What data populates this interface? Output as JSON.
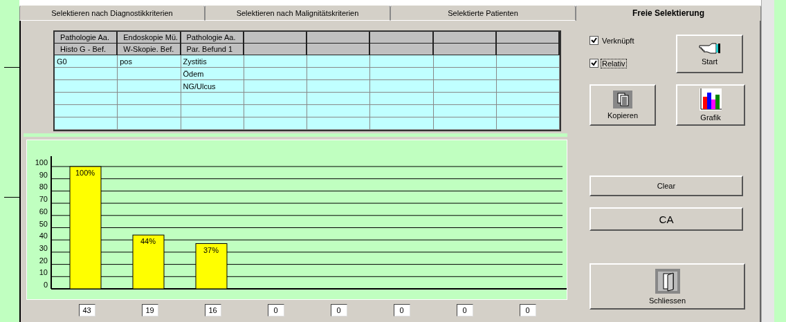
{
  "tabs": [
    {
      "label": "Selektieren nach Diagnostikkriterien",
      "selected": false
    },
    {
      "label": "Selektieren nach Malignitätskriterien",
      "selected": false
    },
    {
      "label": "Selektierte Patienten",
      "selected": false
    },
    {
      "label": "Freie Selektierung",
      "selected": true
    }
  ],
  "table": {
    "columns": [
      {
        "source": "Pathologie Aa.",
        "name": "Histo G - Bef."
      },
      {
        "source": "Endoskopie Mü.",
        "name": "W-Skopie. Bef."
      },
      {
        "source": "Pathologie Aa.",
        "name": "Par. Befund 1"
      }
    ],
    "rows": [
      {
        "cells": [
          "G0",
          "pos",
          "Zystitis"
        ]
      },
      {
        "cells": [
          null,
          null,
          "Ödem"
        ]
      },
      {
        "cells": [
          null,
          null,
          "NG/Ulcus"
        ]
      }
    ]
  },
  "chart_data": {
    "type": "bar",
    "grid": true,
    "ylim": [
      0,
      100
    ],
    "yticks": [
      0,
      10,
      20,
      30,
      40,
      50,
      60,
      70,
      80,
      90,
      100
    ],
    "values": [
      100,
      44,
      37,
      0,
      0,
      0,
      0,
      0
    ],
    "value_labels": [
      "100%",
      "44%",
      "37%",
      null,
      null,
      null,
      null,
      null
    ]
  },
  "counts": [
    "43",
    "19",
    "16",
    "0",
    "0",
    "0",
    "0",
    "0"
  ],
  "options": [
    {
      "label": "Verknüpft",
      "checked": true,
      "focused": false
    },
    {
      "label": "Relativ",
      "checked": true,
      "focused": true
    }
  ],
  "actions": {
    "start": "Start",
    "copy": "Kopieren",
    "chart": "Grafik",
    "clear": "Clear",
    "ca": "CA",
    "close": "Schliessen"
  }
}
